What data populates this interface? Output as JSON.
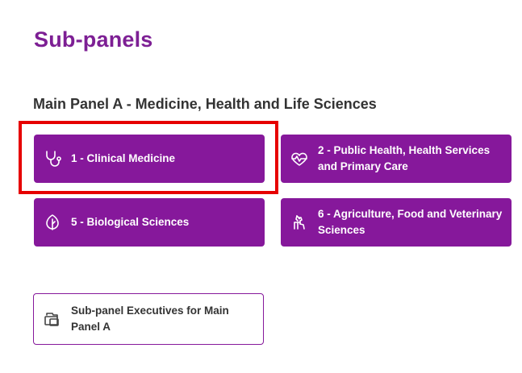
{
  "page": {
    "title": "Sub-panels"
  },
  "section": {
    "title": "Main Panel A - Medicine, Health and Life Sciences"
  },
  "tiles": [
    {
      "label": "1 - Clinical Medicine",
      "icon": "stethoscope-icon"
    },
    {
      "label": "2 - Public Health, Health Services and Primary Care",
      "icon": "heart-pulse-icon"
    },
    {
      "label": "5 - Biological Sciences",
      "icon": "leaf-icon"
    },
    {
      "label": "6 - Agriculture, Food and Veterinary Sciences",
      "icon": "dog-icon"
    }
  ],
  "executives": {
    "label": "Sub-panel Executives for Main Panel A",
    "icon": "folders-icon"
  },
  "colors": {
    "title": "#7d1f94",
    "tile_background": "#86189b",
    "tile_text": "#ffffff",
    "highlight_border": "#e60000",
    "section_text": "#333333"
  }
}
